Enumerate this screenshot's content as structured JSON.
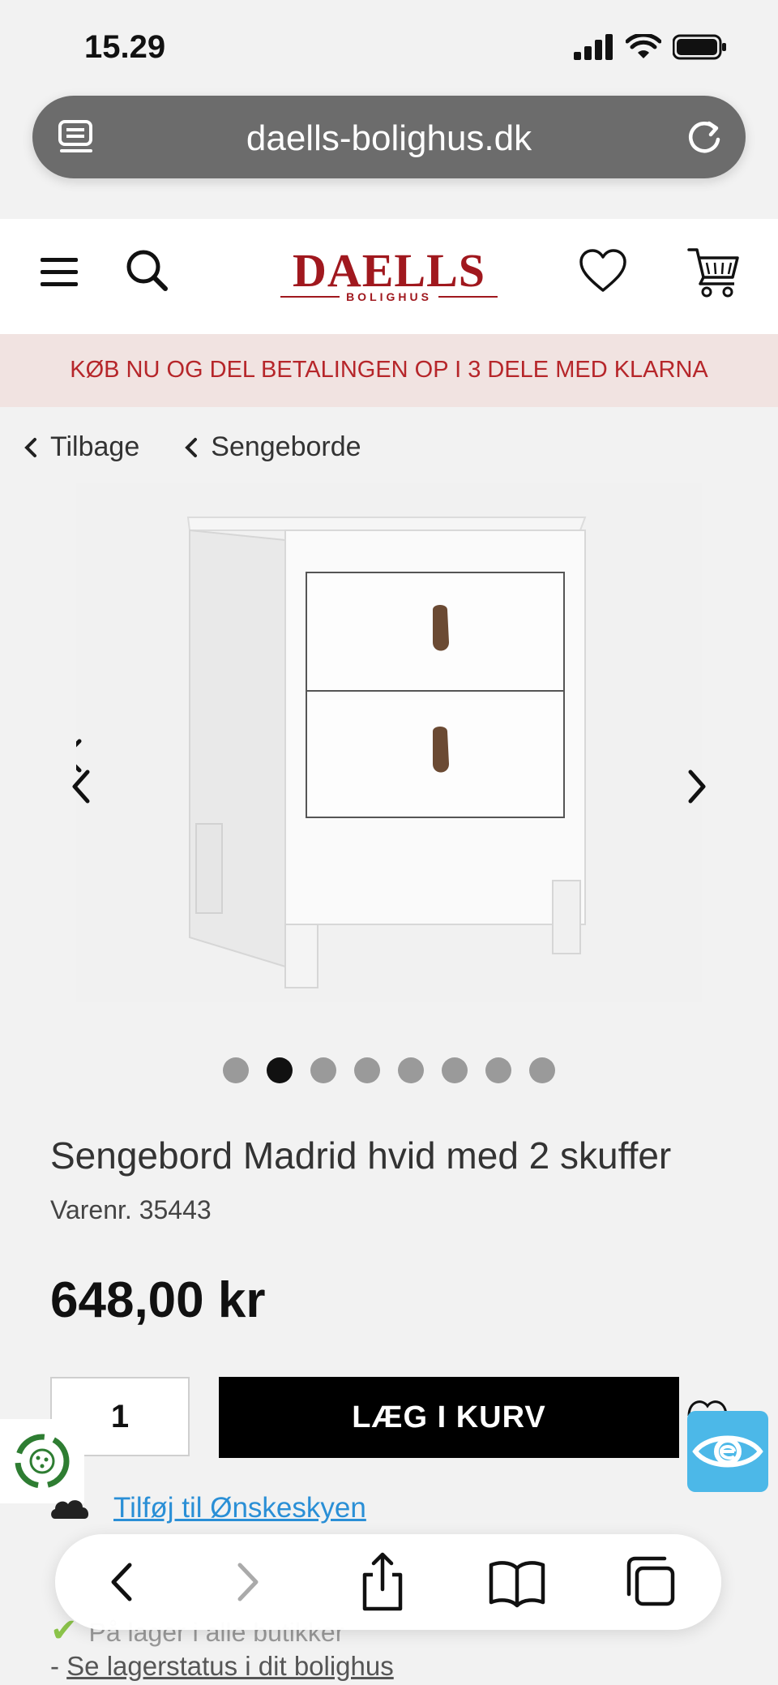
{
  "status": {
    "time": "15.29"
  },
  "browser": {
    "url": "daells-bolighus.dk"
  },
  "header": {
    "logo_main": "DAELLS",
    "logo_sub": "BOLIGHUS"
  },
  "banner": {
    "text": "KØB NU OG DEL BETALINGEN OP I 3 DELE MED KLARNA"
  },
  "breadcrumbs": [
    {
      "label": "Tilbage"
    },
    {
      "label": "Sengeborde"
    }
  ],
  "gallery": {
    "image_count": 8,
    "active_index": 1
  },
  "product": {
    "title": "Sengebord Madrid hvid med 2 skuffer",
    "sku": "Varenr. 35443",
    "price": "648,00 kr",
    "quantity": "1",
    "add_to_cart": "LÆG I KURV",
    "wishlist": "Tilføj til Ønskeskyen",
    "stock_status": "På lager i alle butikker",
    "stock_link_prefix": "- ",
    "stock_link": "Se lagerstatus i dit bolighus"
  },
  "colors": {
    "brand": "#a0181e",
    "banner_bg": "#f1e3e1",
    "link": "#2a8fd6",
    "eye_badge": "#4cb8e8"
  }
}
